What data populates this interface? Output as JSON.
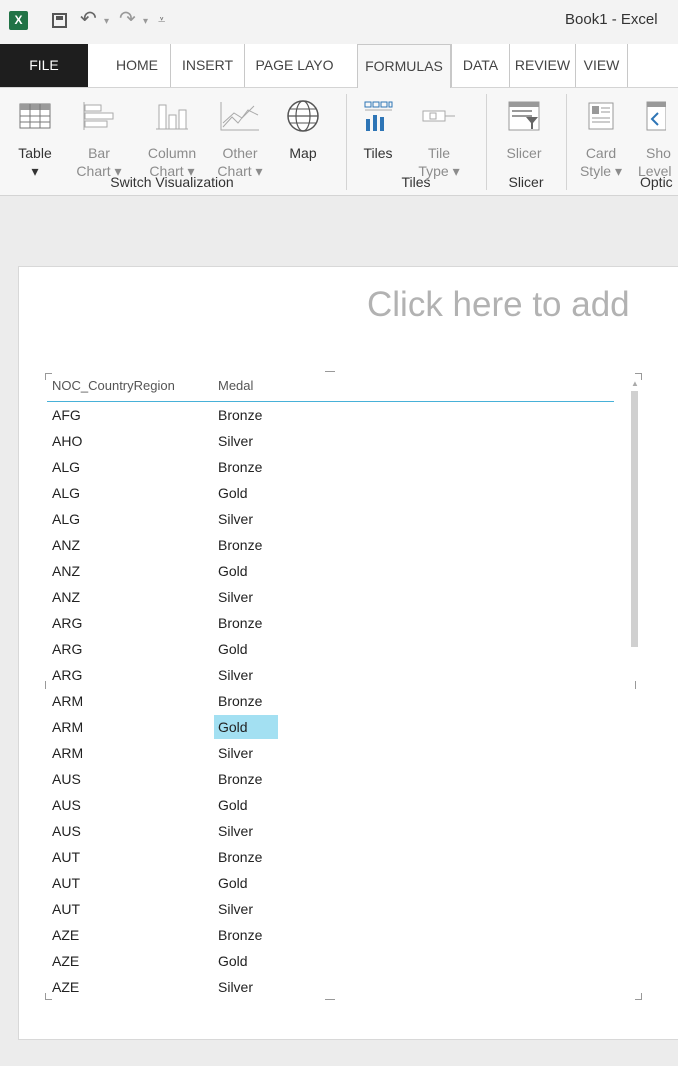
{
  "titlebar": {
    "excel_icon": "X",
    "title": "Book1 - Excel",
    "icons": [
      "excel-icon",
      "save-icon",
      "undo-icon",
      "redo-icon",
      "customize-qat-icon"
    ]
  },
  "tabs": [
    "FILE",
    "HOME",
    "INSERT",
    "PAGE LAYO",
    "FORMULAS",
    "DATA",
    "REVIEW",
    "VIEW"
  ],
  "ribbon": {
    "table": {
      "label": "Table",
      "sub": "▾"
    },
    "bar_chart": {
      "label": "Bar",
      "sub": "Chart ▾"
    },
    "column_chart": {
      "label": "Column",
      "sub": "Chart ▾"
    },
    "other_chart": {
      "label": "Other",
      "sub": "Chart ▾"
    },
    "map": {
      "label": "Map",
      "sub": ""
    },
    "tiles": {
      "label": "Tiles",
      "sub": ""
    },
    "tile_type": {
      "label": "Tile",
      "sub": "Type ▾"
    },
    "slicer": {
      "label": "Slicer",
      "sub": ""
    },
    "card_style": {
      "label": "Card",
      "sub": "Style ▾"
    },
    "show_levels": {
      "label": "Sho",
      "sub": "Level"
    },
    "groups": {
      "switch_visualization": "Switch Visualization",
      "tiles": "Tiles",
      "slicer": "Slicer",
      "options": "Optic"
    }
  },
  "canvas": {
    "title_placeholder": "Click here to add"
  },
  "table": {
    "columns": [
      "NOC_CountryRegion",
      "Medal"
    ],
    "rows": [
      [
        "AFG",
        "Bronze"
      ],
      [
        "AHO",
        "Silver"
      ],
      [
        "ALG",
        "Bronze"
      ],
      [
        "ALG",
        "Gold"
      ],
      [
        "ALG",
        "Silver"
      ],
      [
        "ANZ",
        "Bronze"
      ],
      [
        "ANZ",
        "Gold"
      ],
      [
        "ANZ",
        "Silver"
      ],
      [
        "ARG",
        "Bronze"
      ],
      [
        "ARG",
        "Gold"
      ],
      [
        "ARG",
        "Silver"
      ],
      [
        "ARM",
        "Bronze"
      ],
      [
        "ARM",
        "Gold"
      ],
      [
        "ARM",
        "Silver"
      ],
      [
        "AUS",
        "Bronze"
      ],
      [
        "AUS",
        "Gold"
      ],
      [
        "AUS",
        "Silver"
      ],
      [
        "AUT",
        "Bronze"
      ],
      [
        "AUT",
        "Gold"
      ],
      [
        "AUT",
        "Silver"
      ],
      [
        "AZE",
        "Bronze"
      ],
      [
        "AZE",
        "Gold"
      ],
      [
        "AZE",
        "Silver"
      ]
    ],
    "selected_row": 12
  },
  "colors": {
    "file_tab": "#1e1e1e",
    "excel_green": "#217346",
    "tiles_blue": "#2e75b6",
    "selection": "#a3e0f2",
    "header_rule": "#47b1d8"
  }
}
